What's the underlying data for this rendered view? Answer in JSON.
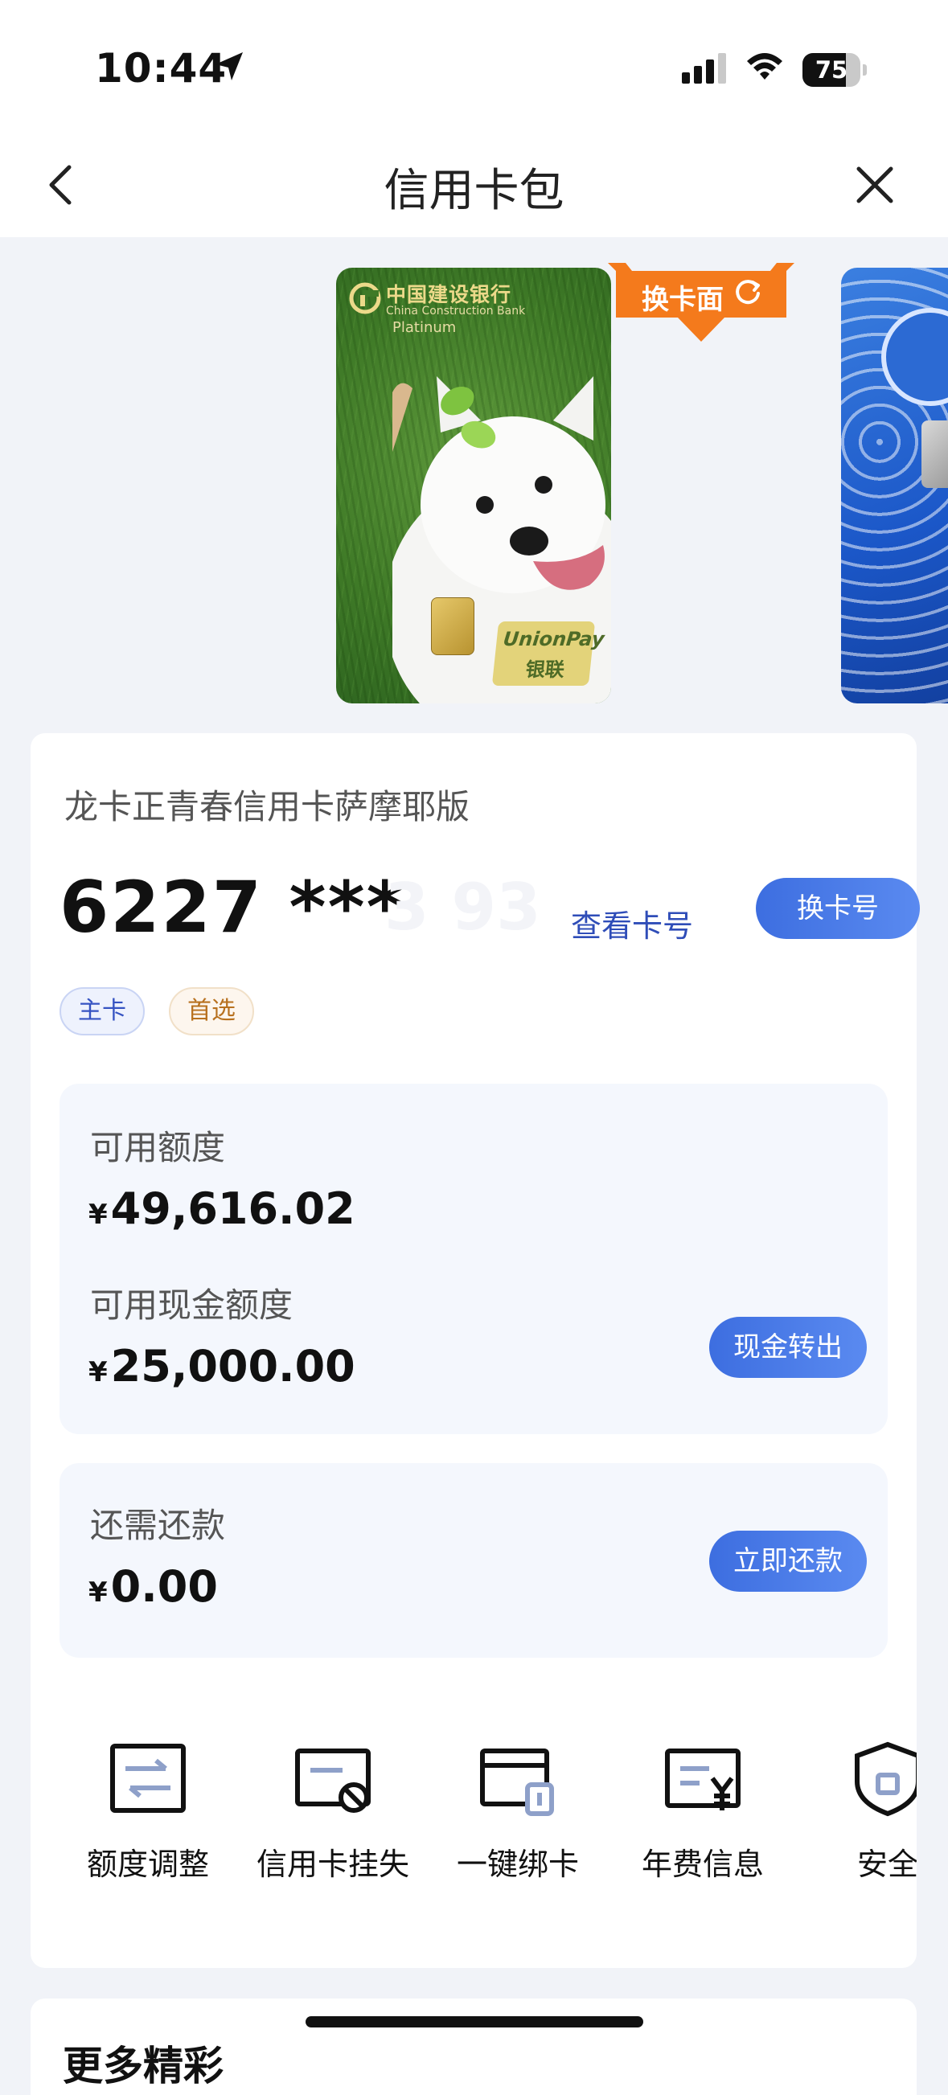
{
  "status_bar": {
    "time": "10:44",
    "battery_percent": "75",
    "battery_level": 0.75
  },
  "nav": {
    "title": "信用卡包"
  },
  "carousel": {
    "swap_face_label": "换卡面",
    "card": {
      "bank_name_cn": "中国建设银行",
      "bank_name_en": "China Construction Bank",
      "tier": "Platinum",
      "unionpay_en": "UnionPay",
      "unionpay_cn": "银联"
    }
  },
  "card_info": {
    "name": "龙卡正青春信用卡萨摩耶版",
    "number_masked": "6227 ***",
    "number_tail": "3 93",
    "view_number_label": "查看卡号",
    "swap_number_label": "换卡号",
    "tags": [
      "主卡",
      "首选"
    ]
  },
  "limits": {
    "available_label": "可用额度",
    "available_currency": "¥",
    "available_amount": "49,616.02",
    "cash_label": "可用现金额度",
    "cash_currency": "¥",
    "cash_amount": "25,000.00",
    "cash_out_button": "现金转出"
  },
  "repayment": {
    "label": "还需还款",
    "currency": "¥",
    "amount": "0.00",
    "button": "立即还款"
  },
  "quick_actions": [
    {
      "label": "额度调整",
      "icon": "limit-adjust-icon"
    },
    {
      "label": "信用卡挂失",
      "icon": "card-loss-icon"
    },
    {
      "label": "一键绑卡",
      "icon": "bind-card-icon"
    },
    {
      "label": "年费信息",
      "icon": "annual-fee-icon"
    },
    {
      "label": "安全",
      "icon": "security-shield-icon"
    }
  ],
  "more_section": {
    "title": "更多精彩"
  },
  "colors": {
    "accent": "#3d6ee0",
    "swap_face_orange": "#f47a1c",
    "tag_blue": "#3553c2",
    "tag_orange": "#b8711f"
  }
}
